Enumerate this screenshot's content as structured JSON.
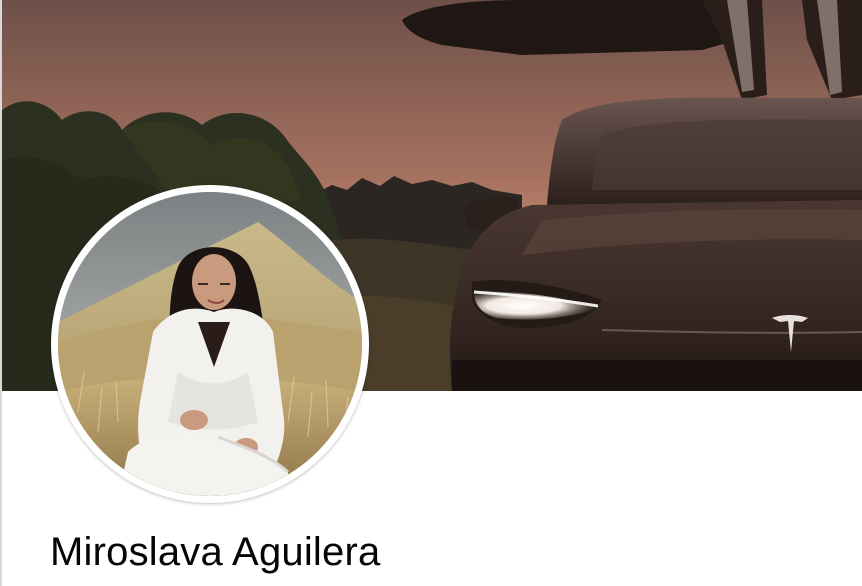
{
  "profile": {
    "name": "Miroslava Aguilera"
  },
  "cover": {
    "image": "cover-photo-car-sunset",
    "colors": {
      "sky_top": "#7a5a52",
      "sky_bottom": "#d39a7c",
      "car_body": "#3a2a25"
    }
  },
  "avatar": {
    "image": "profile-photo-woman-white-suit-field",
    "border_color": "#ffffff"
  }
}
